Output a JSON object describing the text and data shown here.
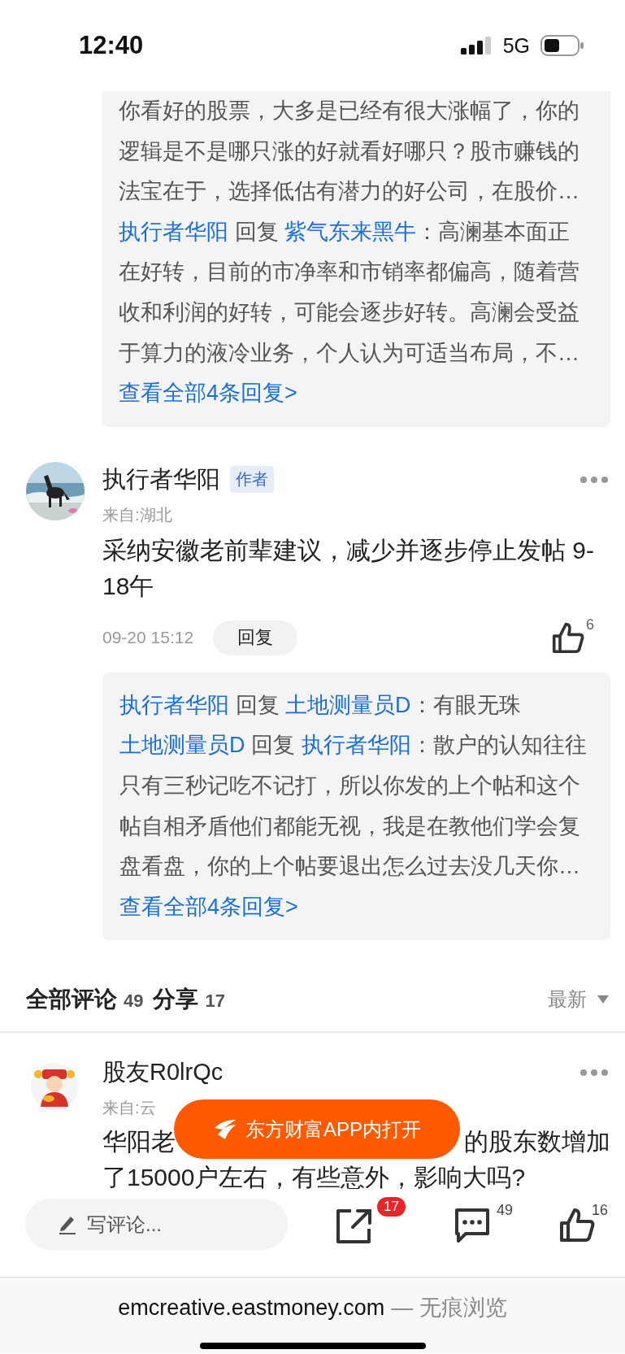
{
  "status_bar": {
    "time": "12:40",
    "network": "5G"
  },
  "top_replies": {
    "replies": [
      {
        "text": "你看好的股票，大多是已经有很大涨幅了，你的逻辑是不是哪只涨的好就看好哪只？股市赚钱的法宝在于，选择低估有潜力的好公司，在股价…"
      },
      {
        "author": "执行者华阳",
        "action": "回复",
        "target": "紫气东来黑牛",
        "text": "：高澜基本面正在好转，目前的市净率和市销率都偏高，随着营收和利润的好转，可能会逐步好转。高澜会受益于算力的液冷业务，个人认为可适当布局，不…"
      }
    ],
    "more_link": "查看全部4条回复>"
  },
  "comment": {
    "author": "执行者华阳",
    "badge": "作者",
    "location": "来自:湖北",
    "text": "采纳安徽老前辈建议，减少并逐步停止发帖 9-18午",
    "time": "09-20 15:12",
    "reply_button": "回复",
    "likes": "6",
    "replies": {
      "replies": [
        {
          "author": "执行者华阳",
          "action": "回复",
          "target": "土地测量员D",
          "text": "：有眼无珠"
        },
        {
          "author": "土地测量员D",
          "action": "回复",
          "target": "执行者华阳",
          "text": "：散户的认知往往只有三秒记吃不记打，所以你发的上个帖和这个帖自相矛盾他们都能无视，我是在教他们学会复盘看盘，你的上个帖要退出怎么过去没几天你…"
        }
      ],
      "more_link": "查看全部4条回复>"
    }
  },
  "comments_header": {
    "comments_label": "全部评论",
    "comments_count": "49",
    "shares_label": "分享",
    "shares_count": "17",
    "sort": "最新"
  },
  "next_comment": {
    "author": "股友R0lrQc",
    "location": "来自:云",
    "text_parts": [
      "华阳老",
      "的股东数增加",
      "了15000户左右，有些意外，影响大吗?"
    ]
  },
  "open_app_button": "东方财富APP内打开",
  "toolbar": {
    "comment_field": {
      "placeholder": "写评论..."
    },
    "share_count": "17",
    "comment_count": "49",
    "like_count": "16"
  },
  "browser_bar": {
    "url": "emcreative.eastmoney.com",
    "mode": "— 无痕浏览"
  }
}
